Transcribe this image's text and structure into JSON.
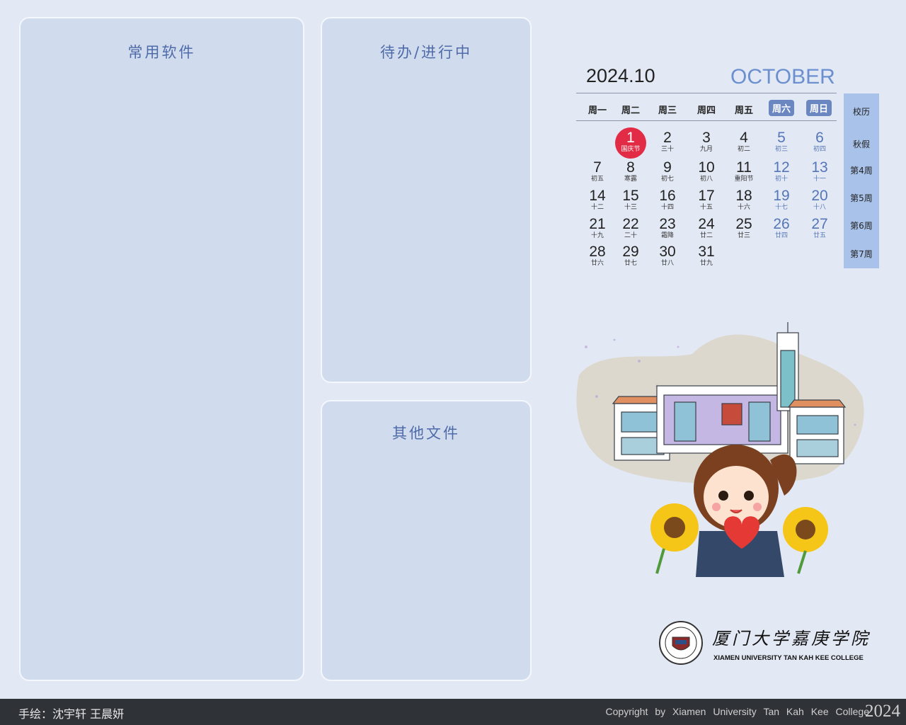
{
  "panels": {
    "software": "常用软件",
    "todo": "待办/进行中",
    "other": "其他文件"
  },
  "calendar": {
    "year_month": "2024.10",
    "month_name": "OCTOBER",
    "weekdays": [
      "周一",
      "周二",
      "周三",
      "周四",
      "周五",
      "周六",
      "周日"
    ],
    "days": [
      {
        "n": "1",
        "l": "国庆节"
      },
      {
        "n": "2",
        "l": "三十"
      },
      {
        "n": "3",
        "l": "九月"
      },
      {
        "n": "4",
        "l": "初二"
      },
      {
        "n": "5",
        "l": "初三"
      },
      {
        "n": "6",
        "l": "初四"
      },
      {
        "n": "7",
        "l": "初五"
      },
      {
        "n": "8",
        "l": "寒露"
      },
      {
        "n": "9",
        "l": "初七"
      },
      {
        "n": "10",
        "l": "初八"
      },
      {
        "n": "11",
        "l": "重阳节"
      },
      {
        "n": "12",
        "l": "初十"
      },
      {
        "n": "13",
        "l": "十一"
      },
      {
        "n": "14",
        "l": "十二"
      },
      {
        "n": "15",
        "l": "十三"
      },
      {
        "n": "16",
        "l": "十四"
      },
      {
        "n": "17",
        "l": "十五"
      },
      {
        "n": "18",
        "l": "十六"
      },
      {
        "n": "19",
        "l": "十七"
      },
      {
        "n": "20",
        "l": "十八"
      },
      {
        "n": "21",
        "l": "十九"
      },
      {
        "n": "22",
        "l": "二十"
      },
      {
        "n": "23",
        "l": "霜降"
      },
      {
        "n": "24",
        "l": "廿二"
      },
      {
        "n": "25",
        "l": "廿三"
      },
      {
        "n": "26",
        "l": "廿四"
      },
      {
        "n": "27",
        "l": "廿五"
      },
      {
        "n": "28",
        "l": "廿六"
      },
      {
        "n": "29",
        "l": "廿七"
      },
      {
        "n": "30",
        "l": "廿八"
      },
      {
        "n": "31",
        "l": "廿九"
      }
    ],
    "side": [
      "校历",
      "秋假",
      "第4周",
      "第5周",
      "第6周",
      "第7周"
    ],
    "today_color": "#e22b45",
    "weekend_color": "#5476b8"
  },
  "logo": {
    "cn": "厦门大学嘉庚学院",
    "en": "XIAMEN UNIVERSITY TAN KAH KEE COLLEGE"
  },
  "footer": {
    "credit": "手绘：沈宇轩  王晨妍",
    "copyright": "Copyright by Xiamen University Tan Kah Kee College",
    "year": "2024"
  }
}
